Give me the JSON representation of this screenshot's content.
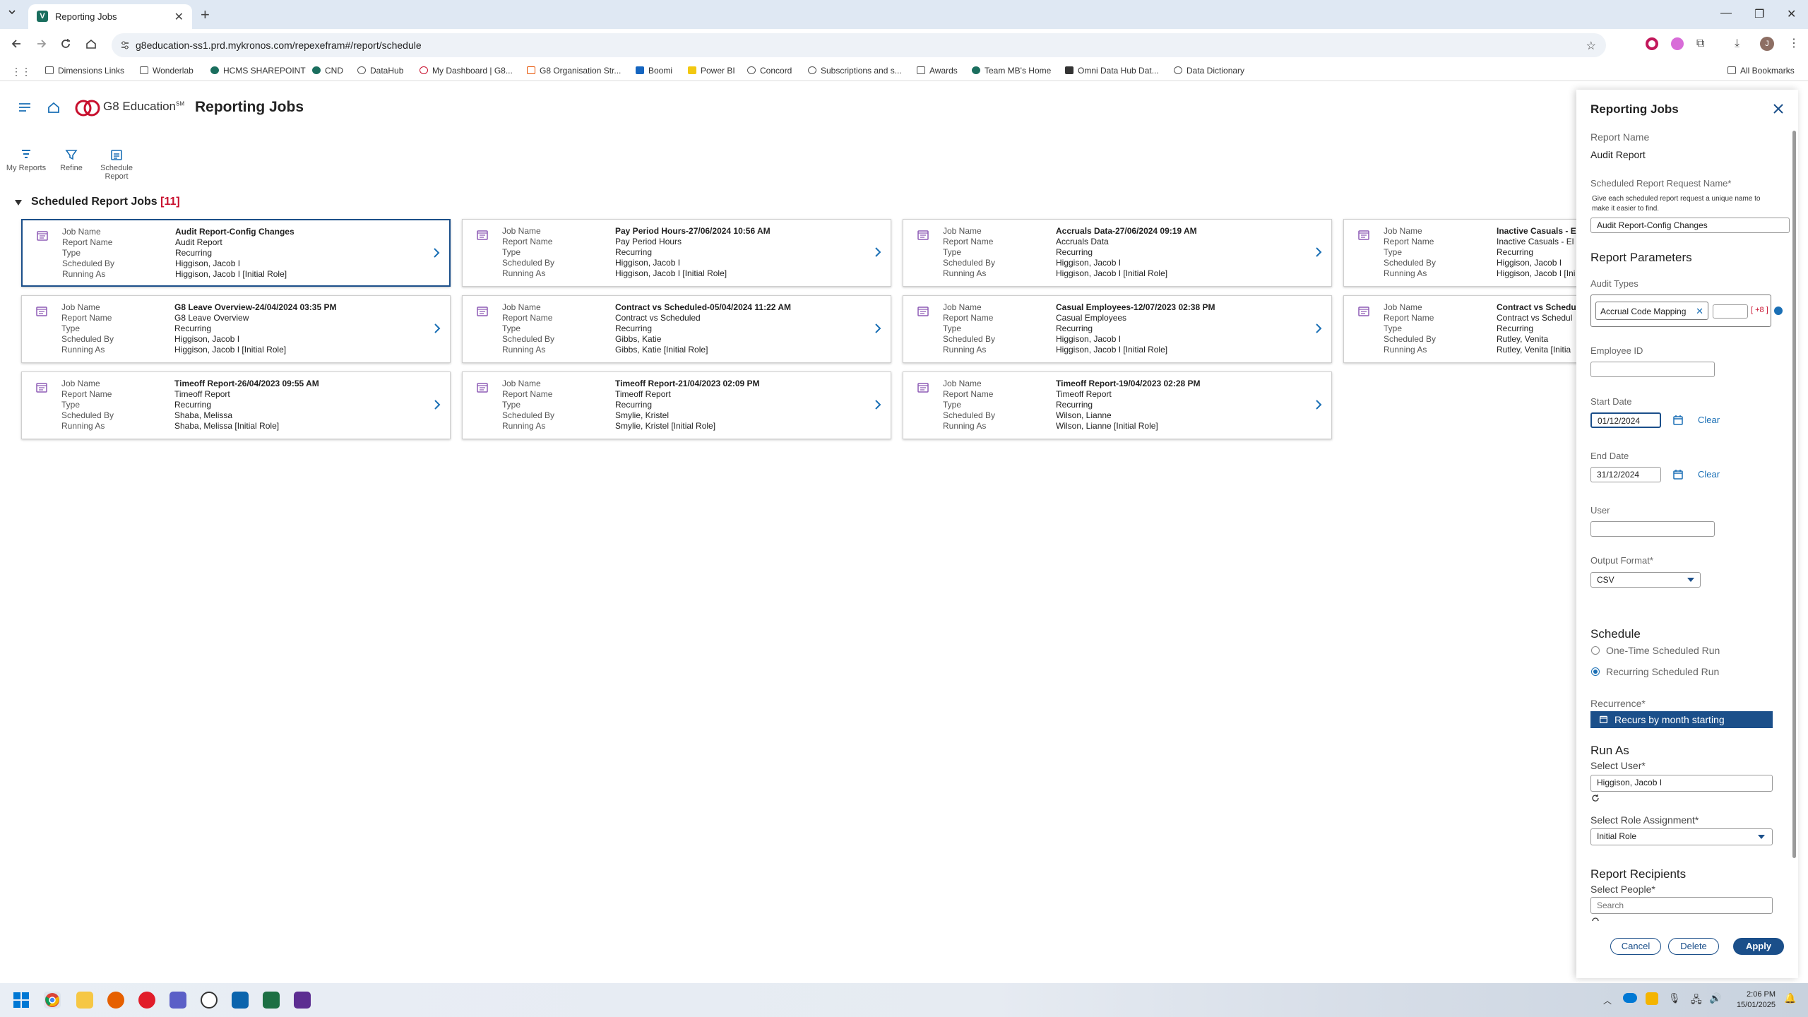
{
  "browser": {
    "tab_title": "Reporting Jobs",
    "url": "g8education-ss1.prd.mykronos.com/repexefram#/report/schedule",
    "bookmarks": [
      "Dimensions Links",
      "Wonderlab",
      "HCMS SHAREPOINT",
      "CND",
      "DataHub",
      "My Dashboard | G8...",
      "G8 Organisation Str...",
      "Boomi",
      "Power BI",
      "Concord",
      "Subscriptions and s...",
      "Awards",
      "Team MB's Home",
      "Omni Data Hub Dat...",
      "Data Dictionary"
    ],
    "all_bookmarks": "All Bookmarks",
    "profile_initial": "J"
  },
  "app": {
    "brand": "G8 Education",
    "brand_tm": "SM",
    "page_title": "Reporting Jobs",
    "tools": [
      {
        "label_1": "My Reports",
        "label_2": "",
        "icon": "my-reports-icon"
      },
      {
        "label_1": "Refine",
        "label_2": "",
        "icon": "filter-icon"
      },
      {
        "label_1": "Schedule",
        "label_2": "Report",
        "icon": "schedule-report-icon"
      }
    ],
    "section": {
      "title": "Scheduled Report Jobs",
      "count": "[11]"
    },
    "field_labels": [
      "Job Name",
      "Report Name",
      "Type",
      "Scheduled By",
      "Running As"
    ],
    "cards": [
      {
        "job": "Audit Report-Config Changes",
        "report": "Audit Report",
        "type": "Recurring",
        "by": "Higgison, Jacob I",
        "as": "Higgison, Jacob I [Initial Role]"
      },
      {
        "job": "Pay Period Hours-27/06/2024 10:56 AM",
        "report": "Pay Period Hours",
        "type": "Recurring",
        "by": "Higgison, Jacob I",
        "as": "Higgison, Jacob I [Initial Role]"
      },
      {
        "job": "Accruals Data-27/06/2024 09:19 AM",
        "report": "Accruals Data",
        "type": "Recurring",
        "by": "Higgison, Jacob I",
        "as": "Higgison, Jacob I [Initial Role]"
      },
      {
        "job": "Inactive Casuals - E",
        "report": "Inactive Casuals - El",
        "type": "Recurring",
        "by": "Higgison, Jacob I",
        "as": "Higgison, Jacob I [Ini"
      },
      {
        "job": "G8 Leave Overview-24/04/2024 03:35 PM",
        "report": "G8 Leave Overview",
        "type": "Recurring",
        "by": "Higgison, Jacob I",
        "as": "Higgison, Jacob I [Initial Role]"
      },
      {
        "job": "Contract vs Scheduled-05/04/2024 11:22 AM",
        "report": "Contract vs Scheduled",
        "type": "Recurring",
        "by": "Gibbs, Katie",
        "as": "Gibbs, Katie [Initial Role]"
      },
      {
        "job": "Casual Employees-12/07/2023 02:38 PM",
        "report": "Casual Employees",
        "type": "Recurring",
        "by": "Higgison, Jacob I",
        "as": "Higgison, Jacob I [Initial Role]"
      },
      {
        "job": "Contract vs Schedu",
        "report": "Contract vs Schedul",
        "type": "Recurring",
        "by": "Rutley, Venita",
        "as": "Rutley, Venita [Initia"
      },
      {
        "job": "Timeoff Report-26/04/2023 09:55 AM",
        "report": "Timeoff Report",
        "type": "Recurring",
        "by": "Shaba, Melissa",
        "as": "Shaba, Melissa [Initial Role]"
      },
      {
        "job": "Timeoff Report-21/04/2023 02:09 PM",
        "report": "Timeoff Report",
        "type": "Recurring",
        "by": "Smylie, Kristel",
        "as": "Smylie, Kristel [Initial Role]"
      },
      {
        "job": "Timeoff Report-19/04/2023 02:28 PM",
        "report": "Timeoff Report",
        "type": "Recurring",
        "by": "Wilson, Lianne",
        "as": "Wilson, Lianne [Initial Role]"
      }
    ]
  },
  "panel": {
    "title": "Reporting Jobs",
    "report_name_label": "Report Name",
    "report_name_value": "Audit Report",
    "request_name_label": "Scheduled Report Request Name",
    "request_name_hint_1": "Give each scheduled report request a unique name to",
    "request_name_hint_2": "make it easier to find.",
    "request_name_value": "Audit Report-Config Changes",
    "params_heading": "Report Parameters",
    "audit_types_label": "Audit Types",
    "audit_chip": "Accrual Code Mapping",
    "audit_more": "[ +8 ]",
    "employee_id_label": "Employee ID",
    "employee_id_value": "",
    "start_date_label": "Start Date",
    "start_date_value": "01/12/2024",
    "end_date_label": "End Date",
    "end_date_value": "31/12/2024",
    "clear_label": "Clear",
    "user_label": "User",
    "user_value": "",
    "output_label": "Output Format",
    "output_value": "CSV",
    "schedule_heading": "Schedule",
    "schedule_opt1": "One-Time Scheduled Run",
    "schedule_opt2": "Recurring Scheduled Run",
    "recurrence_label": "Recurrence",
    "recurrence_value": "Recurs by month starting",
    "runas_heading": "Run As",
    "select_user_label": "Select User",
    "select_user_value": "Higgison, Jacob I",
    "role_label": "Select Role Assignment",
    "role_value": "Initial Role",
    "recipients_heading": "Report Recipients",
    "people_label": "Select People",
    "people_placeholder": "Search",
    "required_mark": "*",
    "cancel": "Cancel",
    "delete": "Delete",
    "apply": "Apply"
  },
  "taskbar": {
    "time": "2:06 PM",
    "date": "15/01/2025"
  }
}
